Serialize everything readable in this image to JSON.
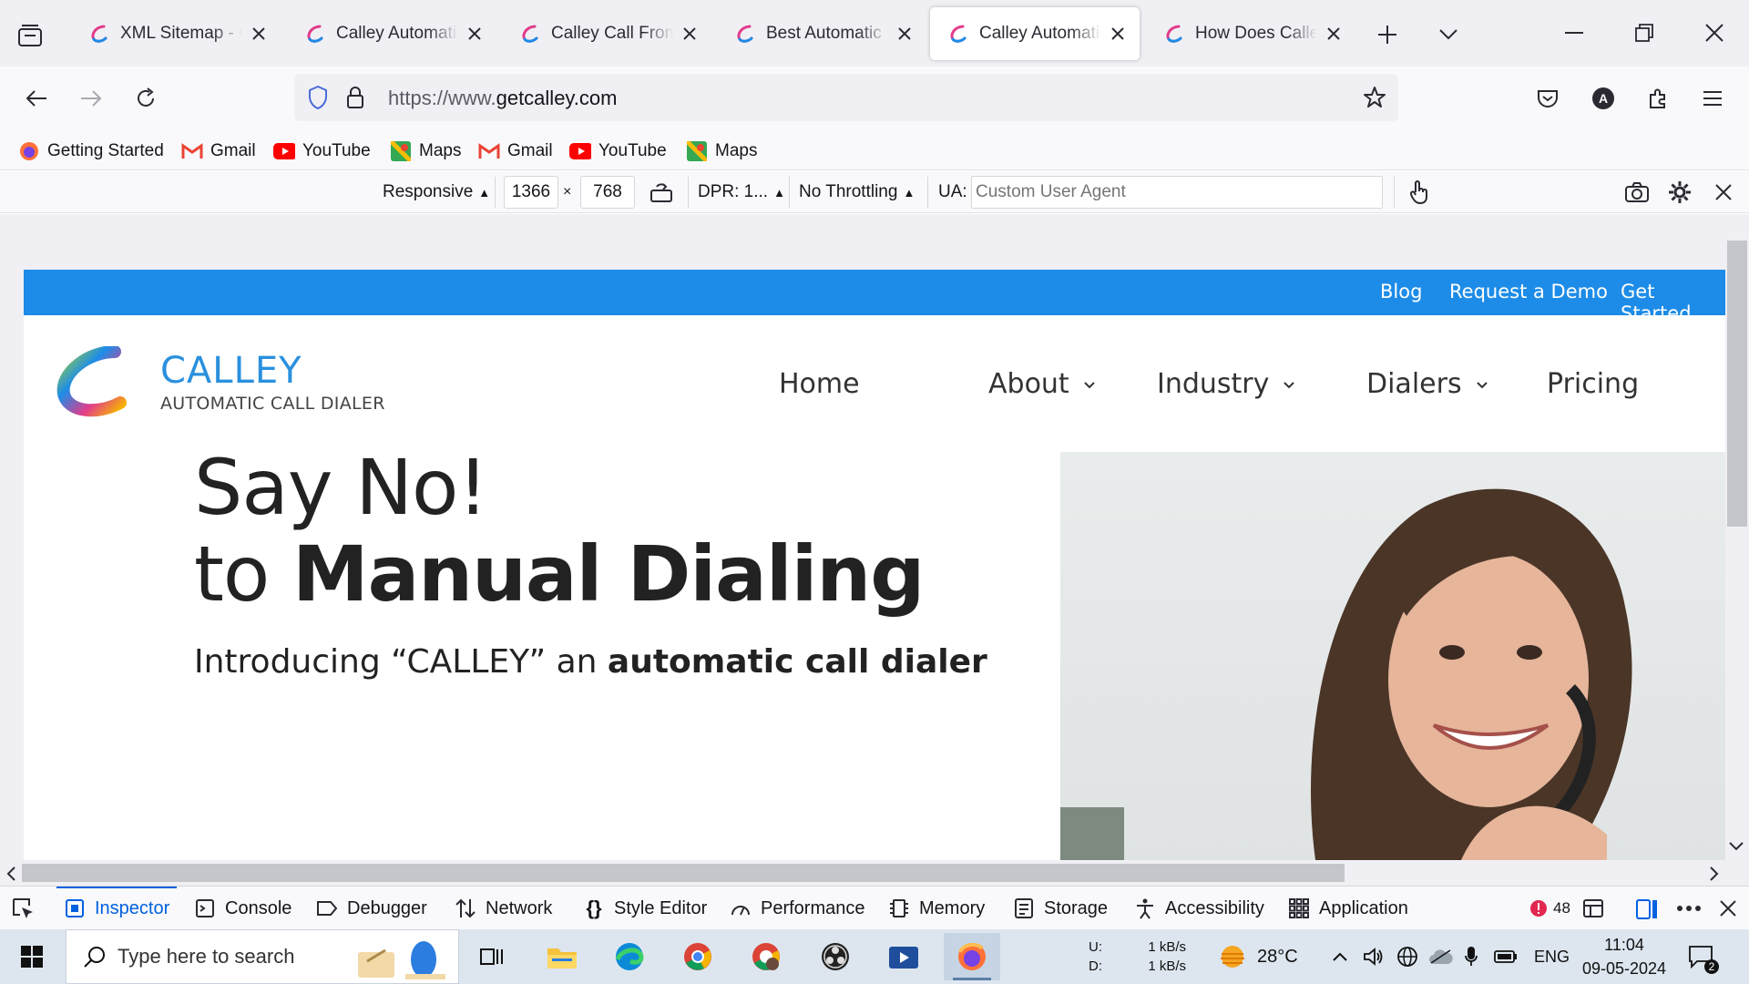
{
  "tabs": [
    {
      "label": "XML Sitemap - C",
      "active": false
    },
    {
      "label": "Calley Automatic",
      "active": false
    },
    {
      "label": "Calley Call From",
      "active": false
    },
    {
      "label": "Best Automatic C",
      "active": false
    },
    {
      "label": "Calley Automatic",
      "active": true
    },
    {
      "label": "How Does Calley",
      "active": false
    }
  ],
  "address_bar": {
    "url_prefix": "https://www.",
    "url_domain": "getcalley.com"
  },
  "bookmarks": [
    {
      "label": "Getting Started",
      "icon": "firefox-icon"
    },
    {
      "label": "Gmail",
      "icon": "gmail-icon"
    },
    {
      "label": "YouTube",
      "icon": "youtube-icon"
    },
    {
      "label": "Maps",
      "icon": "maps-icon"
    },
    {
      "label": "Gmail",
      "icon": "gmail-icon"
    },
    {
      "label": "YouTube",
      "icon": "youtube-icon"
    },
    {
      "label": "Maps",
      "icon": "maps-icon"
    }
  ],
  "rdm": {
    "device": "Responsive",
    "width": "1366",
    "times": "×",
    "height": "768",
    "dpr": "DPR: 1...",
    "throttling": "No Throttling",
    "ua_label": "UA:",
    "ua_placeholder": "Custom User Agent"
  },
  "site": {
    "topbar_links": [
      "Blog",
      "Request a Demo",
      "Get Started"
    ],
    "brand_name": "CALLEY",
    "brand_tagline": "AUTOMATIC CALL DIALER",
    "menu": [
      {
        "label": "Home",
        "dropdown": false
      },
      {
        "label": "About",
        "dropdown": true
      },
      {
        "label": "Industry",
        "dropdown": true
      },
      {
        "label": "Dialers",
        "dropdown": true
      },
      {
        "label": "Pricing",
        "dropdown": false
      }
    ],
    "hero_line1": "Say No!",
    "hero_line2_plain": "to ",
    "hero_line2_bold": "Manual Dialing",
    "hero_intro_plain": "Introducing “CALLEY” an ",
    "hero_intro_bold": "automatic call dialer",
    "accent_color": "#1d8ce8"
  },
  "devtools": {
    "tabs": [
      "Inspector",
      "Console",
      "Debugger",
      "Network",
      "Style Editor",
      "Performance",
      "Memory",
      "Storage",
      "Accessibility",
      "Application"
    ],
    "active_tab": "Inspector",
    "error_count": "48"
  },
  "taskbar": {
    "search_placeholder": "Type here to search",
    "net_up_label": "U:",
    "net_up": "1 kB/s",
    "net_down_label": "D:",
    "net_down": "1 kB/s",
    "temperature": "28°C",
    "language": "ENG",
    "time": "11:04",
    "date": "09-05-2024",
    "notifications": "2"
  }
}
